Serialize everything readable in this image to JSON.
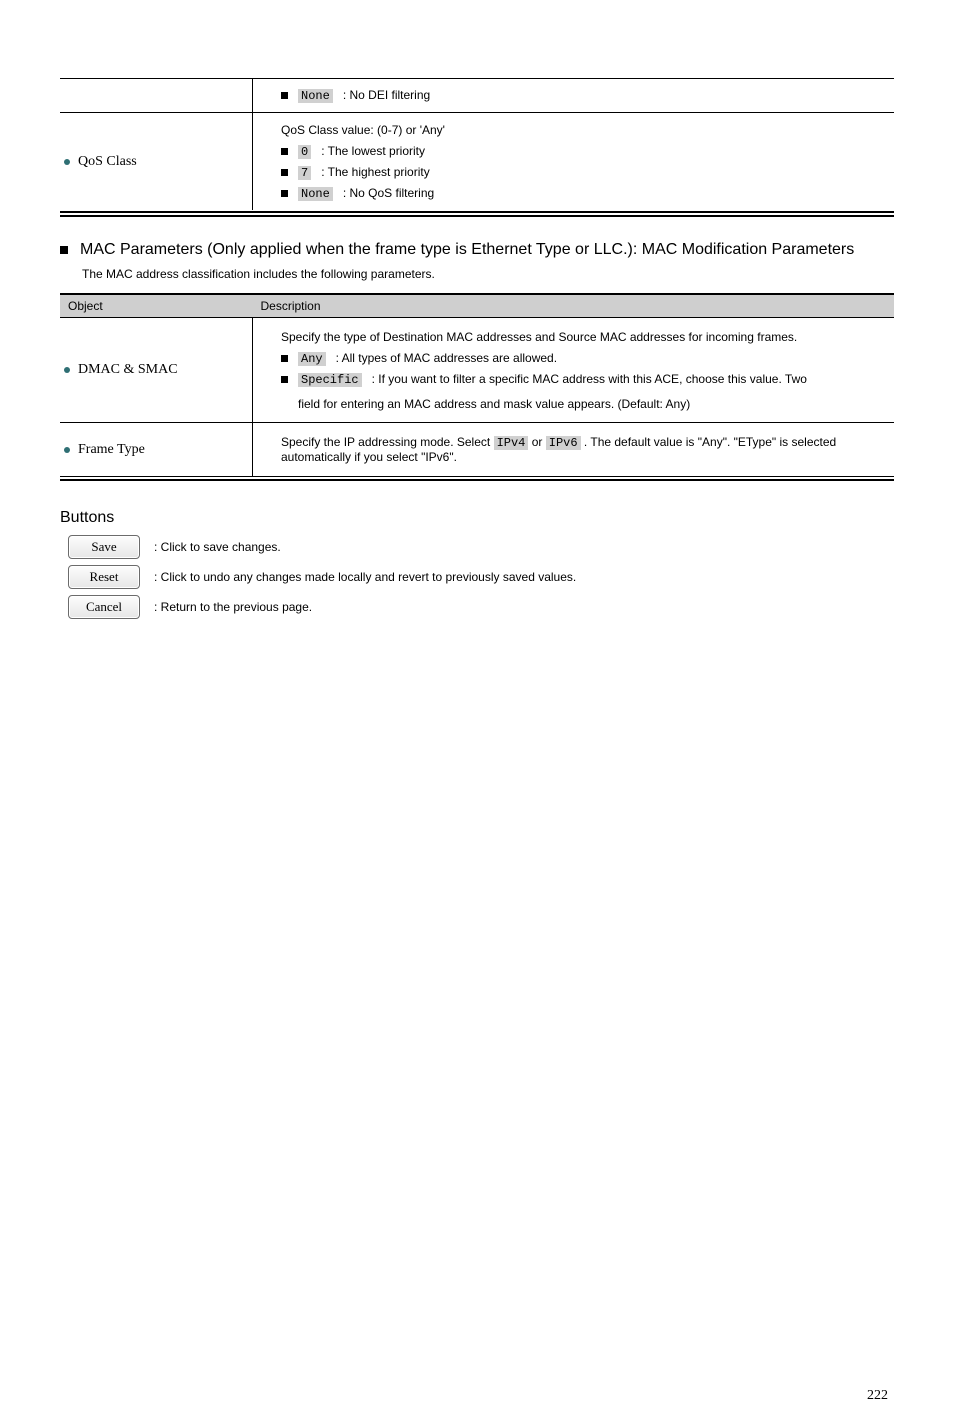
{
  "frag1": {
    "prev": {
      "none": "None",
      "none_rest": ": No DEI filtering"
    },
    "qos": {
      "label": "QoS Class",
      "intro": "QoS Class value: (0-7) or 'Any'",
      "b0": {
        "code": "0",
        "rest": ": The lowest priority"
      },
      "b7": {
        "code": "7",
        "rest": ": The highest priority"
      },
      "bn": {
        "code": "None",
        "rest": ": No QoS filtering"
      }
    }
  },
  "section": {
    "title": "MAC Parameters (Only applied when the frame type is Ethernet Type or LLC.): MAC Modification Parameters",
    "sub": "The MAC address classification includes the following parameters."
  },
  "table2": {
    "h": {
      "left": "Object",
      "right": "Description"
    },
    "r0": {
      "label": "DMAC & SMAC",
      "intro": "Specify the type of Destination MAC addresses and Source MAC addresses for incoming frames.",
      "b0": {
        "code": "Any",
        "rest": ": All types of MAC addresses are allowed."
      },
      "b1": {
        "code": "Specific",
        "rest1": ": If you want to filter a specific MAC address with this ACE, choose this value. Two",
        "rest2": "field for entering an MAC address and mask value appears. (Default: Any)"
      }
    },
    "r1": {
      "label": "Frame Type",
      "t0": "Specify the IP addressing mode. Select",
      "c0": "IPv4",
      "t1": "or",
      "c1": "IPv6",
      "t2": ". The default value is \"Any\". \"EType\" is selected automatically if you select \"IPv6\"."
    }
  },
  "buttons": {
    "title": "Buttons",
    "save": {
      "label": "Save",
      "desc": ": Click to save changes."
    },
    "reset": {
      "label": "Reset",
      "desc": ": Click to undo any changes made locally and revert to previously saved values."
    },
    "cancel": {
      "label": "Cancel",
      "desc": ": Return to the previous page."
    }
  },
  "page_number": "222"
}
